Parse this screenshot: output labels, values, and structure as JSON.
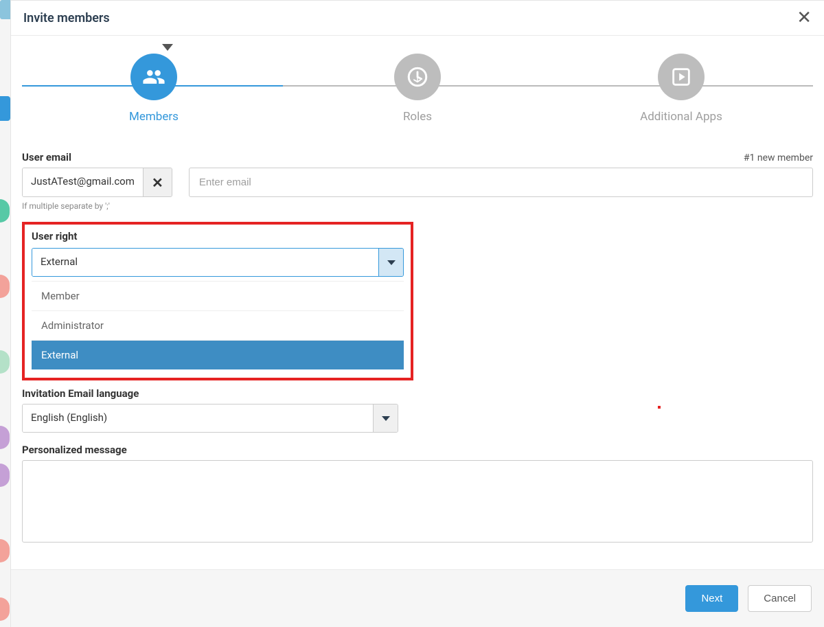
{
  "modal": {
    "title": "Invite members"
  },
  "stepper": {
    "steps": {
      "members": "Members",
      "roles": "Roles",
      "apps": "Additional Apps"
    }
  },
  "form": {
    "user_email_label": "User email",
    "new_member_count": "#1 new member",
    "chip_email": "JustATest@gmail.com",
    "email_placeholder": "Enter email",
    "helper": "If multiple separate by ';'",
    "user_right_label": "User right",
    "user_right_value": "External",
    "user_right_options": {
      "member": "Member",
      "administrator": "Administrator",
      "external": "External"
    },
    "lang_label": "Invitation Email language",
    "lang_value": "English (English)",
    "msg_label": "Personalized message"
  },
  "footer": {
    "next": "Next",
    "cancel": "Cancel"
  }
}
